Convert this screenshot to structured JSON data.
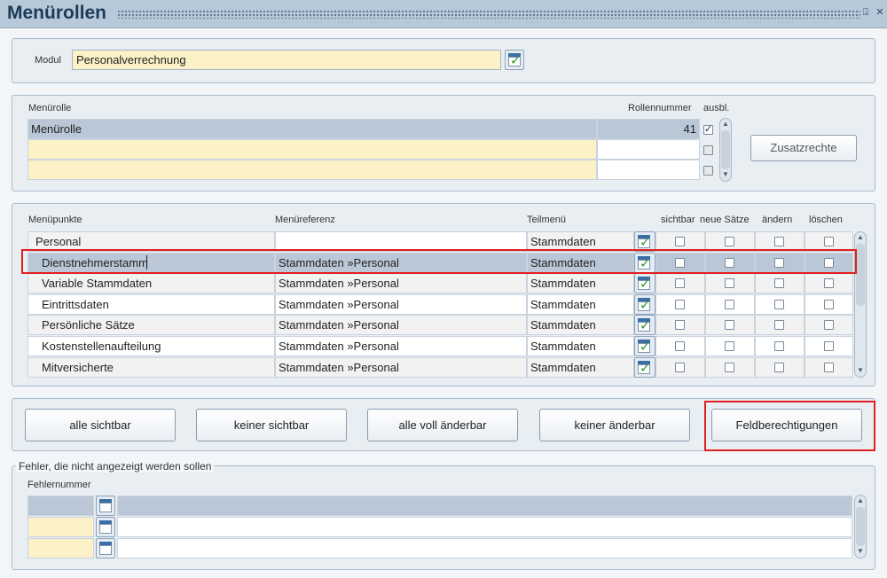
{
  "window": {
    "title": "Menürollen",
    "minimize_glyph": "⍗",
    "close_glyph": "✕"
  },
  "modul": {
    "label": "Modul",
    "value": "Personalverrechnung"
  },
  "rollen": {
    "col_menuerolle": "Menürolle",
    "col_rollennummer": "Rollennummer",
    "col_ausbl": "ausbl.",
    "rows": [
      {
        "name": "Menürolle",
        "number": "41",
        "ausbl": true
      },
      {
        "name": "",
        "number": "",
        "ausbl": false
      },
      {
        "name": "",
        "number": "",
        "ausbl": false
      }
    ],
    "zusatzrechte_label": "Zusatzrechte"
  },
  "menuepunkte": {
    "headers": {
      "menuepunkte": "Menüpunkte",
      "menuereferenz": "Menüreferenz",
      "teilmenue": "Teilmenü",
      "sichtbar": "sichtbar",
      "neue_saetze": "neue Sätze",
      "aendern": "ändern",
      "loeschen": "löschen"
    },
    "rows": [
      {
        "punkt": "Personal",
        "referenz": "",
        "teilmenue": "Stammdaten"
      },
      {
        "punkt": "Dienstnehmerstamm",
        "referenz": "Stammdaten »Personal",
        "teilmenue": "Stammdaten"
      },
      {
        "punkt": "Variable Stammdaten",
        "referenz": "Stammdaten »Personal",
        "teilmenue": "Stammdaten"
      },
      {
        "punkt": "Eintrittsdaten",
        "referenz": "Stammdaten »Personal",
        "teilmenue": "Stammdaten"
      },
      {
        "punkt": "Persönliche Sätze",
        "referenz": "Stammdaten »Personal",
        "teilmenue": "Stammdaten"
      },
      {
        "punkt": "Kostenstellenaufteilung",
        "referenz": "Stammdaten »Personal",
        "teilmenue": "Stammdaten"
      },
      {
        "punkt": "Mitversicherte",
        "referenz": "Stammdaten »Personal",
        "teilmenue": "Stammdaten"
      }
    ],
    "selected_row": 1
  },
  "actions": {
    "alle_sichtbar": "alle sichtbar",
    "keiner_sichtbar": "keiner sichtbar",
    "alle_voll_aenderbar": "alle voll änderbar",
    "keiner_aenderbar": "keiner änderbar",
    "feldberechtigungen": "Feldberechtigungen"
  },
  "fehler": {
    "group_title": "Fehler, die nicht angezeigt werden sollen",
    "col_fehlernummer": "Fehlernummer",
    "rows": [
      {
        "nummer": ""
      },
      {
        "nummer": ""
      },
      {
        "nummer": ""
      }
    ]
  },
  "colors": {
    "titlebar": "#b7c8d8",
    "selected_row": "#b9c7d6",
    "input_yellow": "#fdf1c8",
    "highlight_red": "#e02020",
    "check_green": "#2f9a2f"
  },
  "icons": {
    "calendar_check": "calendar-check-icon",
    "scroll_up": "▲",
    "scroll_down": "▼"
  }
}
